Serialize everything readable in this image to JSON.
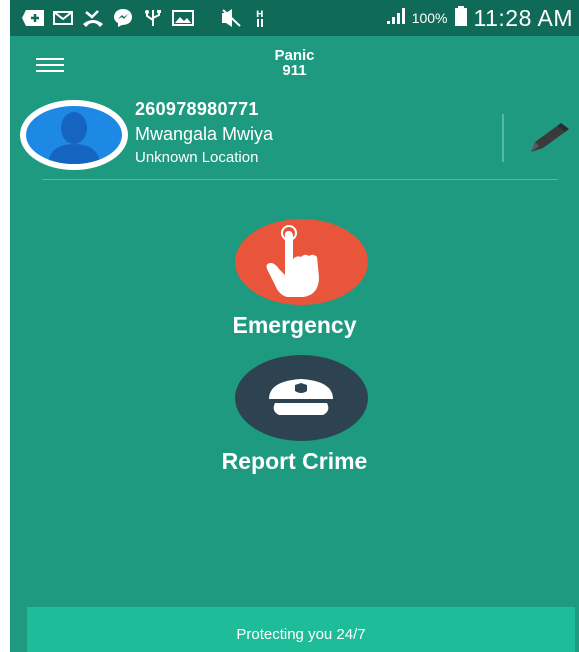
{
  "status_bar": {
    "icons": [
      "add-icon",
      "mail-icon",
      "missed-call-icon",
      "messenger-icon",
      "usb-icon",
      "image-icon",
      "mute-icon",
      "network-icon",
      "signal-icon"
    ],
    "battery_percent": "100%",
    "time": "11:28 AM"
  },
  "app_bar": {
    "title": "Panic",
    "subtitle": "911"
  },
  "profile": {
    "phone": "260978980771",
    "name": "Mwangala Mwiya",
    "location": "Unknown Location"
  },
  "actions": {
    "emergency_label": "Emergency",
    "report_crime_label": "Report Crime"
  },
  "footer": {
    "text": "Protecting you 24/7"
  },
  "colors": {
    "background": "#1e9a80",
    "status_bar": "#0f6b58",
    "emergency": "#e8553a",
    "report_crime": "#2e4351",
    "footer": "#1ebc99",
    "avatar": "#1e88e5"
  }
}
